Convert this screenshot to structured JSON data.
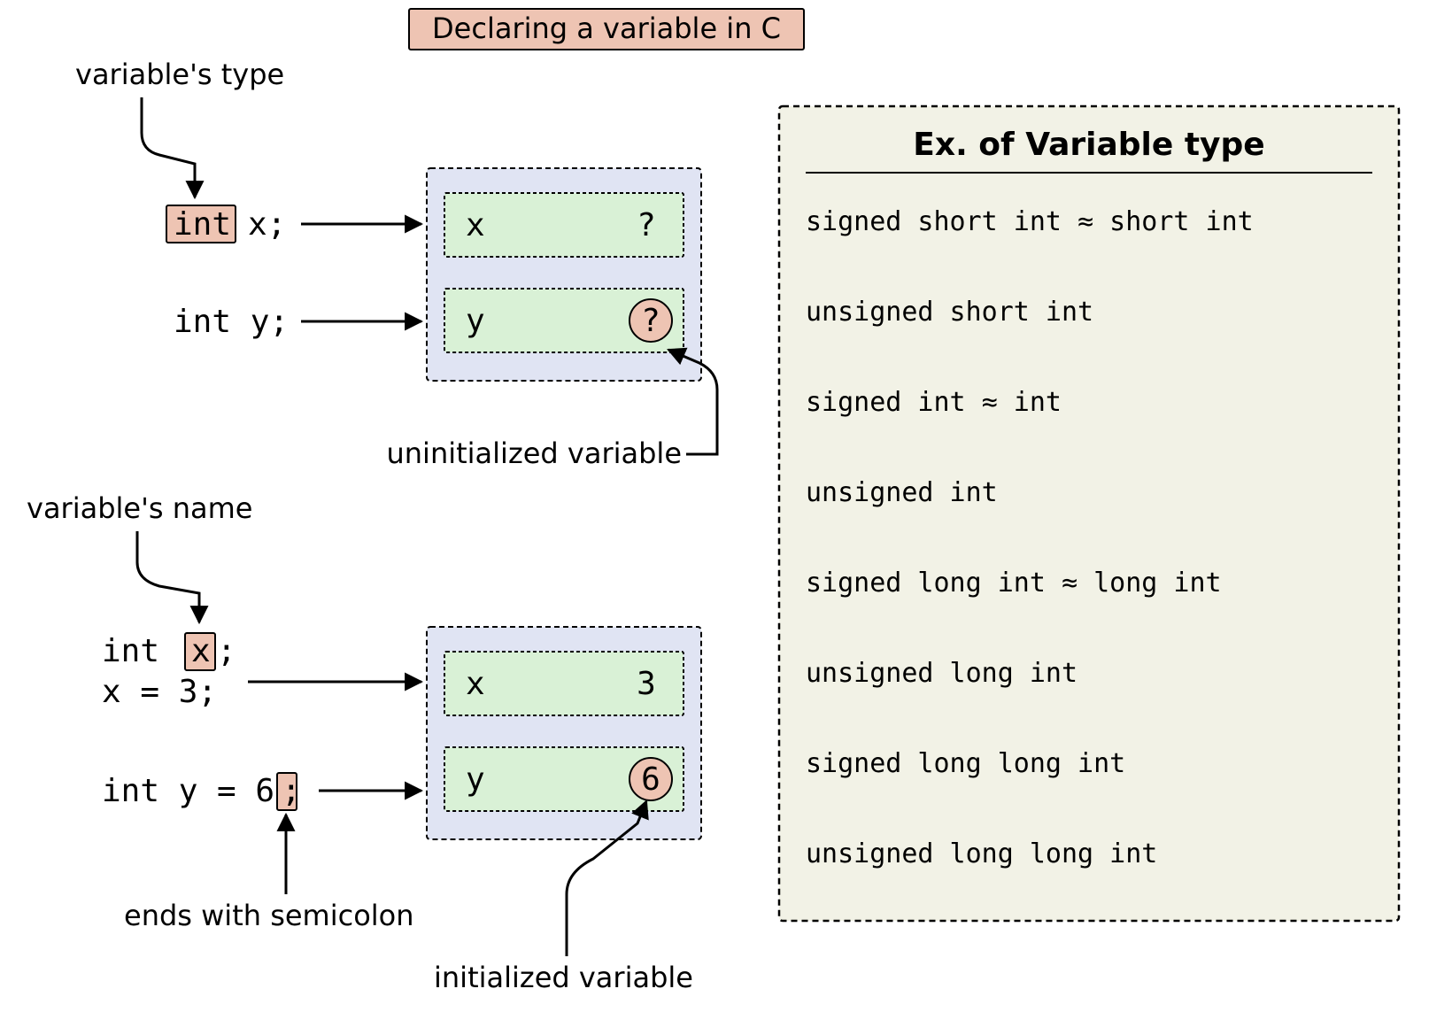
{
  "title": "Declaring a variable in C",
  "annotations": {
    "type_label": "variable's type",
    "name_label": "variable's name",
    "semicolon_label": "ends with semicolon",
    "uninit_label": "uninitialized variable",
    "init_label": "initialized variable"
  },
  "code": {
    "decl_x": "int x;",
    "decl_y": "int y;",
    "decl_x2_a": "int x;",
    "decl_x2_b": "x = 3;",
    "decl_y2": "int y = 6;",
    "type_kw": "int",
    "var_x": "x",
    "semicolon": ";"
  },
  "memory": {
    "top": {
      "rows": [
        {
          "name": "x",
          "value": "?"
        },
        {
          "name": "y",
          "value": "?"
        }
      ]
    },
    "bottom": {
      "rows": [
        {
          "name": "x",
          "value": "3"
        },
        {
          "name": "y",
          "value": "6"
        }
      ]
    }
  },
  "types_panel": {
    "title": "Ex. of Variable type",
    "items": [
      "signed short int ≈ short int",
      "unsigned short int",
      "signed int ≈ int",
      "unsigned int",
      "signed long int ≈ long int",
      "unsigned long int",
      "signed long long int",
      "unsigned long long int"
    ]
  }
}
